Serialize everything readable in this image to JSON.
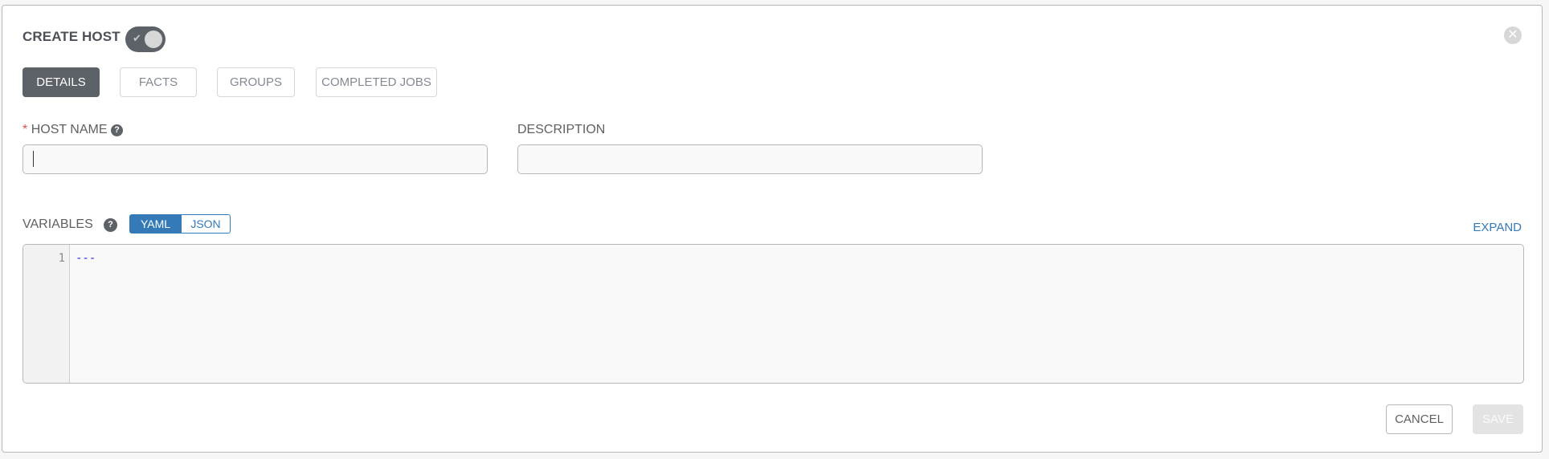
{
  "header": {
    "title": "CREATE HOST",
    "enabled_toggle": {
      "state": "on",
      "icon": "check-icon"
    },
    "close_icon": "close-circle-icon"
  },
  "tabs": [
    {
      "label": "DETAILS",
      "active": true
    },
    {
      "label": "FACTS",
      "active": false
    },
    {
      "label": "GROUPS",
      "active": false
    },
    {
      "label": "COMPLETED JOBS",
      "active": false
    }
  ],
  "form": {
    "host_name": {
      "required_mark": "*",
      "label": "HOST NAME",
      "help_icon": "?",
      "value": "",
      "placeholder": ""
    },
    "description": {
      "label": "DESCRIPTION",
      "value": "",
      "placeholder": ""
    },
    "variables": {
      "label": "VARIABLES",
      "help_icon": "?",
      "format_options": [
        "YAML",
        "JSON"
      ],
      "selected_format": "YAML",
      "expand_label": "EXPAND",
      "lines": [
        {
          "number": "1",
          "text": "---"
        }
      ]
    }
  },
  "actions": {
    "cancel_label": "CANCEL",
    "save_label": "SAVE",
    "save_disabled": true
  },
  "colors": {
    "accent": "#337ab7",
    "active_tab": "#5d6168",
    "required": "#d9534f",
    "yaml_doc_start": "#2222ee"
  }
}
